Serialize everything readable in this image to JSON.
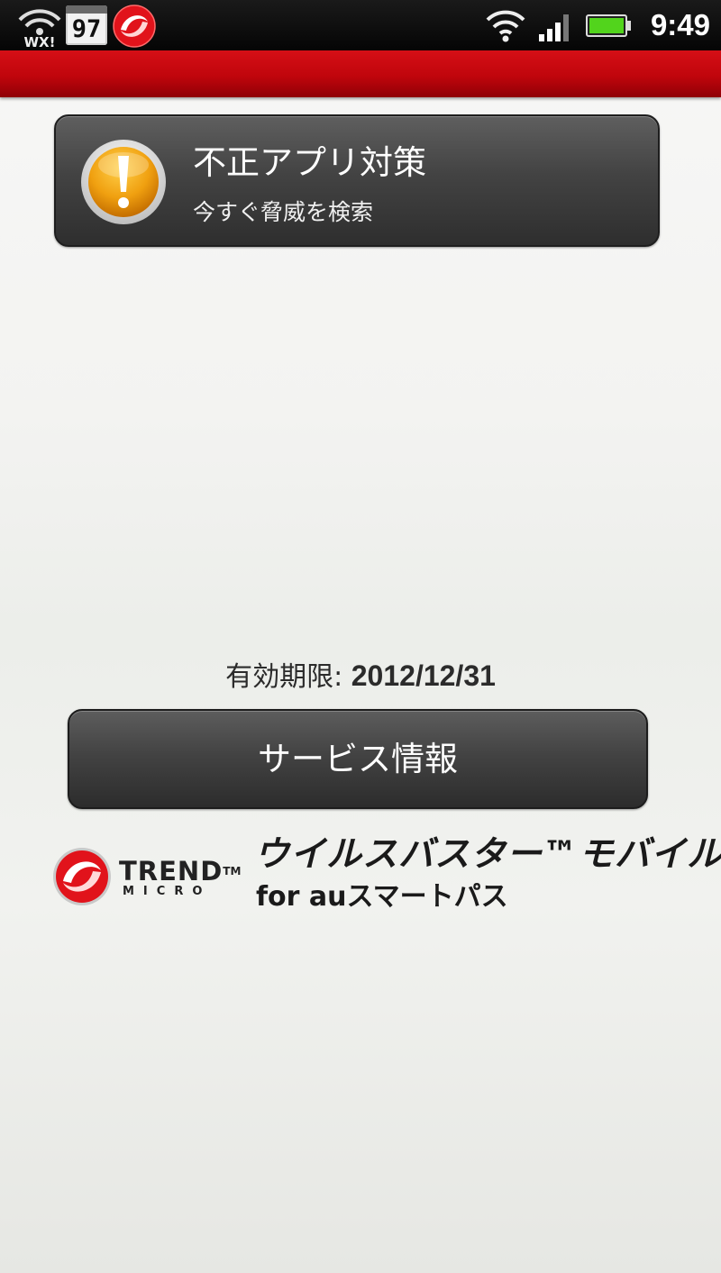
{
  "status_bar": {
    "left_icons": [
      "wx-wifi-icon",
      "calendar-icon",
      "trend-micro-notification-icon"
    ],
    "calendar_day": "97",
    "right_icons": [
      "wifi-icon",
      "signal-icon",
      "battery-icon"
    ],
    "time": "9:49"
  },
  "header": {
    "color": "#c0050c"
  },
  "scan_card": {
    "icon": "warning-icon",
    "title": "不正アプリ対策",
    "subtitle": "今すぐ脅威を検索"
  },
  "expiry": {
    "label": "有効期限:",
    "value": "2012/12/31"
  },
  "service_button": {
    "label": "サービス情報"
  },
  "branding": {
    "company_word": "TREND",
    "company_mark": "TM",
    "company_sub": "MICRO",
    "product_name": "ウイルスバスター™モバイル",
    "product_sub": "for auスマートパス"
  },
  "colors": {
    "accent_red": "#c0050c",
    "button_dark": "#434343",
    "warning_orange": "#f0a010"
  }
}
